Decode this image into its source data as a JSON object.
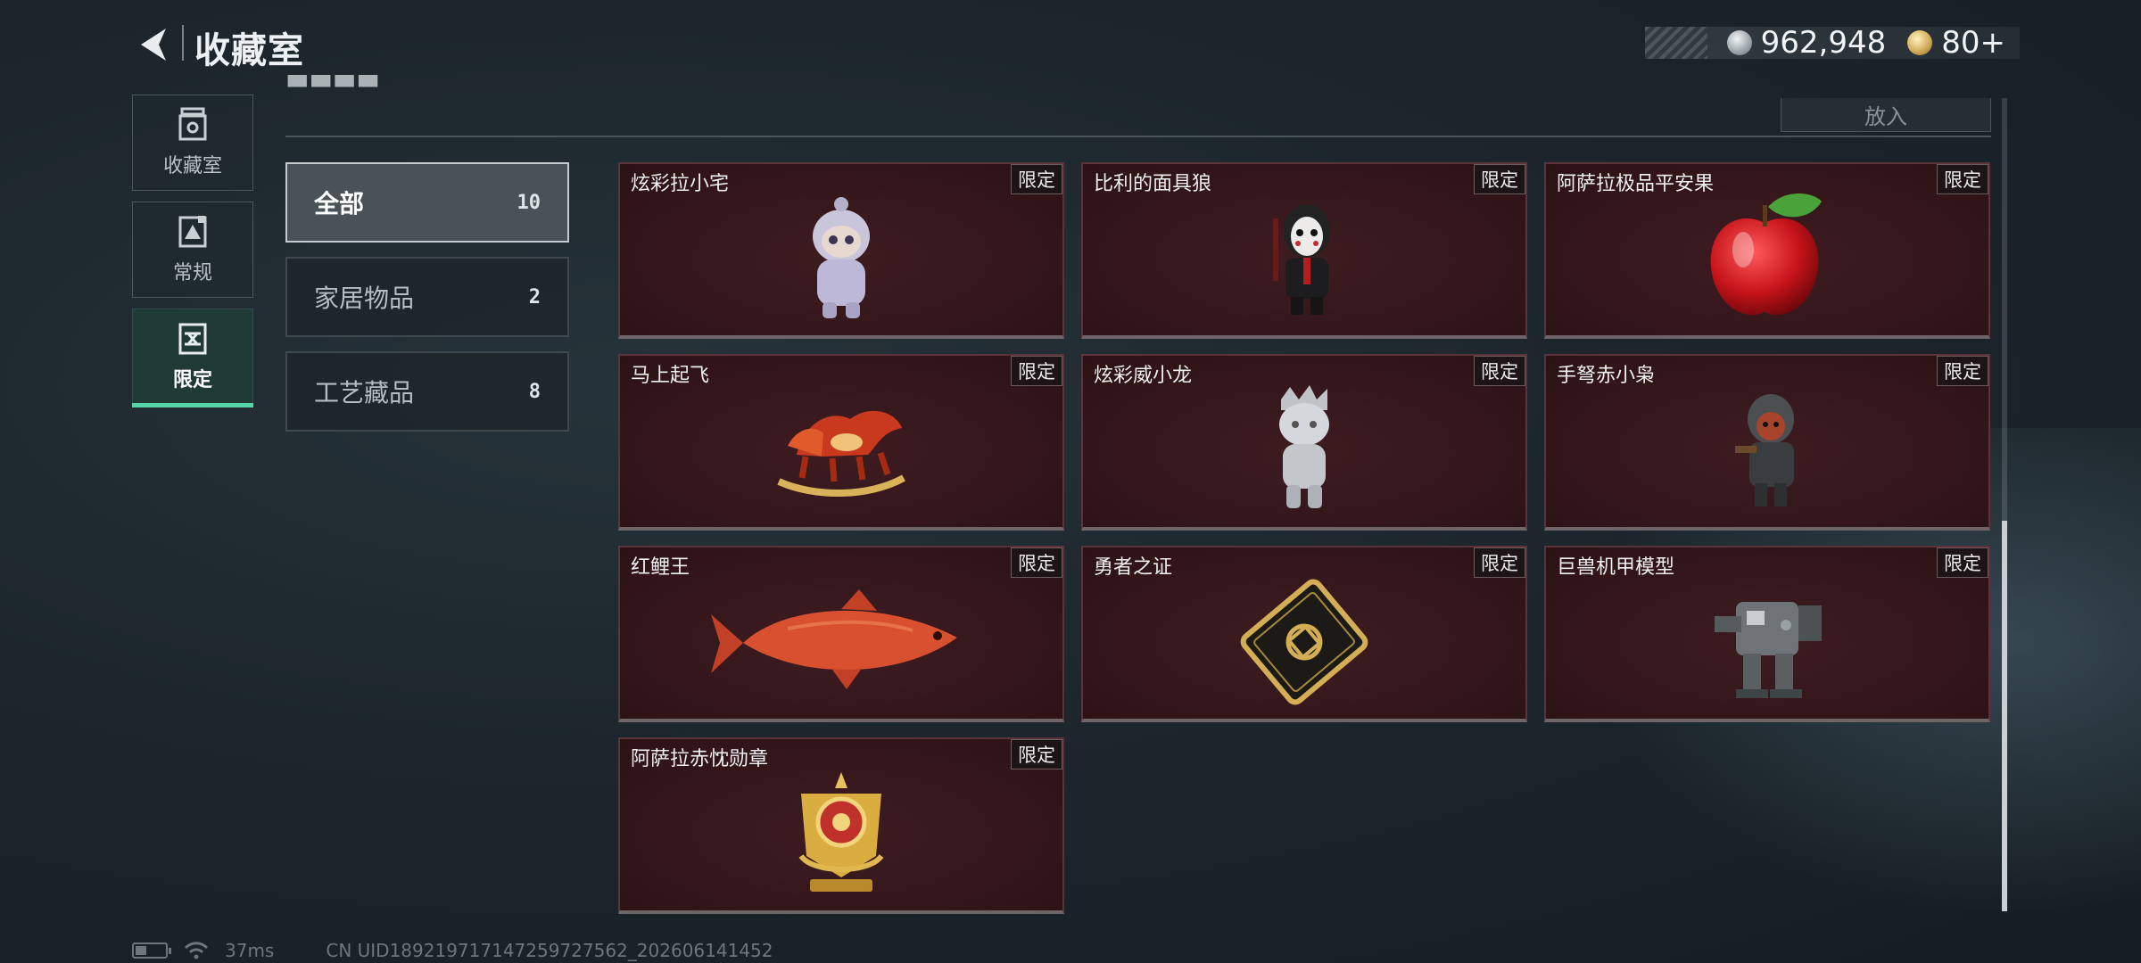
{
  "header": {
    "title": "收藏室",
    "currencies": [
      {
        "icon": "silver-coin-icon",
        "value": "962,948"
      },
      {
        "icon": "gold-coin-icon",
        "value": "80+"
      }
    ]
  },
  "sidebar": {
    "tabs": [
      {
        "label": "收藏室",
        "icon": "collection-room-icon"
      },
      {
        "label": "常规",
        "icon": "regular-icon"
      },
      {
        "label": "限定",
        "icon": "limited-icon",
        "active": true
      }
    ]
  },
  "toolbar": {
    "put_label": "放入"
  },
  "categories": [
    {
      "label": "全部",
      "count": "10",
      "active": true
    },
    {
      "label": "家居物品",
      "count": "2"
    },
    {
      "label": "工艺藏品",
      "count": "8"
    }
  ],
  "badge_label": "限定",
  "items": [
    {
      "name": "炫彩拉小宅",
      "icon": "doll-figure-icon"
    },
    {
      "name": "比利的面具狼",
      "icon": "masked-puppet-icon"
    },
    {
      "name": "阿萨拉极品平安果",
      "icon": "red-apple-icon"
    },
    {
      "name": "马上起飞",
      "icon": "rocking-horse-icon"
    },
    {
      "name": "炫彩威小龙",
      "icon": "silver-figure-icon"
    },
    {
      "name": "手弩赤小枭",
      "icon": "hooded-figure-icon"
    },
    {
      "name": "红鲤王",
      "icon": "red-carp-icon"
    },
    {
      "name": "勇者之证",
      "icon": "gold-card-icon"
    },
    {
      "name": "巨兽机甲模型",
      "icon": "mech-model-icon"
    },
    {
      "name": "阿萨拉赤忱勋章",
      "icon": "gold-medal-icon"
    }
  ],
  "scrollbar": {
    "position": "bottom"
  },
  "footer": {
    "ping": "37ms",
    "uid": "CN UID1892197171472597275​62_202606141452"
  },
  "colors": {
    "accent": "#57d3a8",
    "card_bg": "#321519",
    "background": "#1c262c"
  }
}
